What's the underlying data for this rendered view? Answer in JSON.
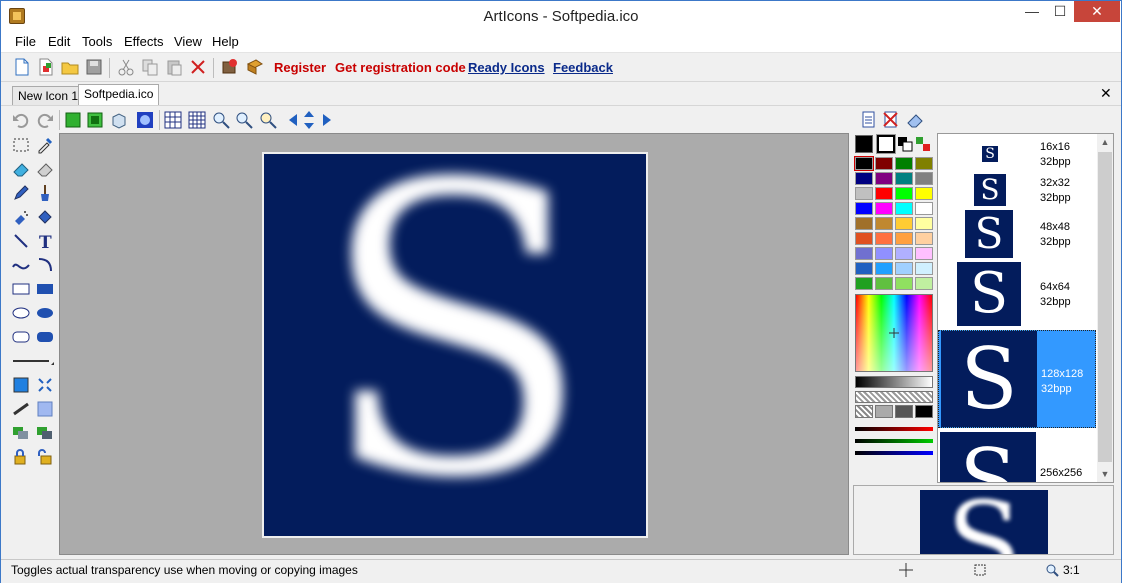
{
  "window": {
    "title": "ArtIcons - Softpedia.ico",
    "minimize": "—",
    "maximize": "☐",
    "close": "✕"
  },
  "menu": {
    "file": "File",
    "edit": "Edit",
    "tools": "Tools",
    "effects": "Effects",
    "view": "View",
    "help": "Help"
  },
  "toolbar": {
    "register": "Register",
    "get_code": "Get registration code",
    "ready_icons": "Ready Icons",
    "feedback": "Feedback"
  },
  "tabs": [
    {
      "label": "New Icon 1"
    },
    {
      "label": "Softpedia.ico"
    }
  ],
  "tabs_close": "✕",
  "canvas": {
    "letter": "S"
  },
  "icons": [
    {
      "size": "16x16",
      "bpp": "32bpp"
    },
    {
      "size": "32x32",
      "bpp": "32bpp"
    },
    {
      "size": "48x48",
      "bpp": "32bpp"
    },
    {
      "size": "64x64",
      "bpp": "32bpp"
    },
    {
      "size": "128x128",
      "bpp": "32bpp"
    },
    {
      "size": "256x256",
      "bpp": ""
    }
  ],
  "palette_colors": [
    "#000000",
    "#800000",
    "#008000",
    "#808000",
    "#000080",
    "#800080",
    "#008080",
    "#808080",
    "#c0c0c0",
    "#ff0000",
    "#00ff00",
    "#ffff00",
    "#0000ff",
    "#ff00ff",
    "#00ffff",
    "#ffffff",
    "#a0702a",
    "#c08830",
    "#ffcc33",
    "#ffffa0",
    "#e05020",
    "#ff7040",
    "#ffa040",
    "#ffd0a0",
    "#7070d0",
    "#9090ff",
    "#b0b0ff",
    "#ffc0ff",
    "#2060c0",
    "#20a0ff",
    "#a0d0ff",
    "#d0f0ff",
    "#20a020",
    "#60c040",
    "#90e060",
    "#c0f0a0"
  ],
  "status": {
    "text": "Toggles actual transparency use when moving or copying images",
    "zoom": "3:1"
  }
}
